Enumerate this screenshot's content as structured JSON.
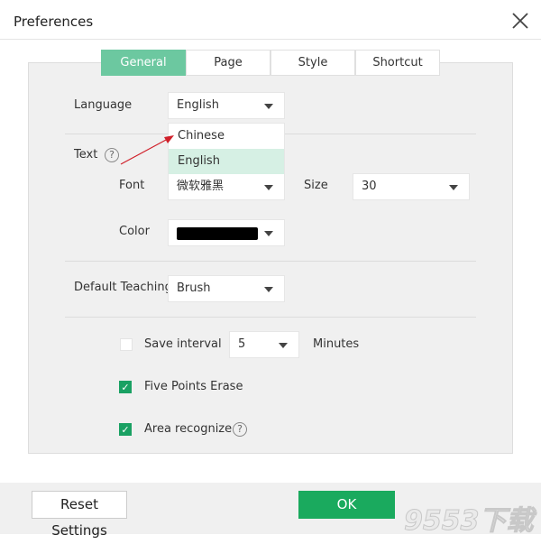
{
  "window": {
    "title": "Preferences",
    "close_icon": "close-icon"
  },
  "tabs": [
    {
      "label": "General",
      "active": true
    },
    {
      "label": "Page"
    },
    {
      "label": "Style"
    },
    {
      "label": "Shortcut"
    }
  ],
  "general": {
    "language": {
      "label": "Language",
      "value": "English",
      "options": [
        "Chinese",
        "English"
      ],
      "highlighted": "English"
    },
    "text": {
      "label": "Text",
      "help": "?",
      "font_label": "Font",
      "font_value": "微软雅黑",
      "size_label": "Size",
      "size_value": "30",
      "color_label": "Color",
      "color_value": "#000000"
    },
    "teaching": {
      "label": "Default Teaching I",
      "value": "Brush"
    },
    "save_interval": {
      "label": "Save interval",
      "checked": false,
      "value": "5",
      "unit": "Minutes"
    },
    "five_points": {
      "label": "Five Points Erase",
      "checked": true
    },
    "area": {
      "label": "Area recognize",
      "checked": true,
      "help": "?"
    }
  },
  "footer": {
    "reset": "Reset Settings",
    "ok": "OK"
  },
  "colors": {
    "accent": "#1aaa5e",
    "tab_active": "#6cc8a0",
    "annotation_arrow": "#d0202a"
  },
  "watermark": "9553下载"
}
